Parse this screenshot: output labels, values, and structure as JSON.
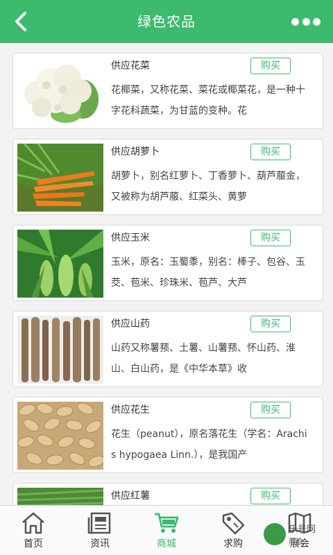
{
  "header": {
    "title": "绿色农品"
  },
  "buy_label": "购买",
  "products": [
    {
      "name": "供应花菜",
      "desc": "花椰菜，又称花菜、菜花或椰菜花，是一种十字花科蔬菜，为甘蓝的变种。花"
    },
    {
      "name": "供应胡萝卜",
      "desc": "胡萝卜，别名红萝卜、丁香萝卜、葫芦菔金，又被称为胡芦菔、红菜头、黄萝"
    },
    {
      "name": "供应玉米",
      "desc": "玉米，原名：玉蜀黍，别名：棒子、包谷、玉茭、苞米、珍珠米、苞芦、大芦"
    },
    {
      "name": "供应山药",
      "desc": "山药又称薯蓣、土薯、山薯蓣、怀山药、淮山、白山药，是《中华本草》收"
    },
    {
      "name": "供应花生",
      "desc": "花生（peanut），原名落花生（学名：Arachis hypogaea Linn.），是我国产"
    },
    {
      "name": "供应红薯",
      "desc": ""
    }
  ],
  "tabs": [
    {
      "label": "首页",
      "icon": "home-icon"
    },
    {
      "label": "资讯",
      "icon": "news-icon"
    },
    {
      "label": "商城",
      "icon": "cart-icon",
      "active": true
    },
    {
      "label": "求购",
      "icon": "tag-icon"
    },
    {
      "label": "展会",
      "icon": "map-icon"
    }
  ],
  "watermark": {
    "text": "乐号网",
    "sub": "展会"
  },
  "colors": {
    "accent": "#3cba6e",
    "background": "#f3f3f3"
  }
}
